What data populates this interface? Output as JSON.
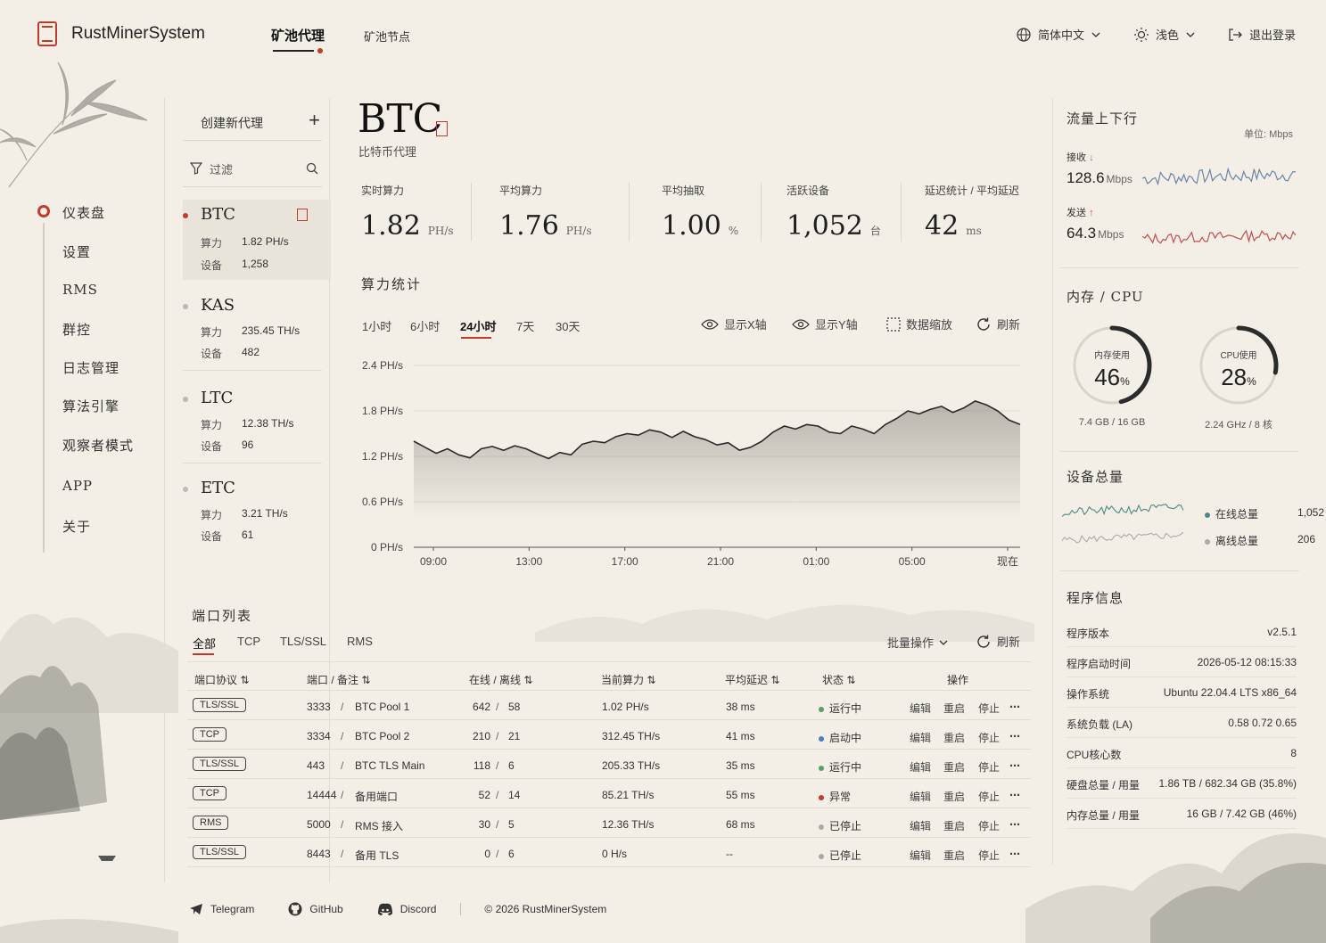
{
  "app": {
    "title": "RustMinerSystem"
  },
  "topnav": {
    "tabs": [
      {
        "label": "矿池代理"
      },
      {
        "label": "矿池节点"
      }
    ],
    "language": "简体中文",
    "theme": "浅色",
    "logout": "退出登录"
  },
  "sidebar": {
    "items": [
      {
        "label": "仪表盘"
      },
      {
        "label": "设置"
      },
      {
        "label": "RMS"
      },
      {
        "label": "群控"
      },
      {
        "label": "日志管理"
      },
      {
        "label": "算法引擎"
      },
      {
        "label": "观察者模式"
      },
      {
        "label": "APP"
      },
      {
        "label": "关于"
      }
    ]
  },
  "proxies": {
    "create_label": "创建新代理",
    "filter_label": "过滤",
    "hash_key": "算力",
    "device_key": "设备",
    "items": [
      {
        "name": "BTC",
        "hash": "1.82 PH/s",
        "devices": "1,258"
      },
      {
        "name": "KAS",
        "hash": "235.45 TH/s",
        "devices": "482"
      },
      {
        "name": "LTC",
        "hash": "12.38 TH/s",
        "devices": "96"
      },
      {
        "name": "ETC",
        "hash": "3.21 TH/s",
        "devices": "61"
      }
    ]
  },
  "main": {
    "coin": "BTC",
    "coin_sub": "比特币代理",
    "stats": [
      {
        "label": "实时算力",
        "value": "1.82",
        "unit": "PH/s"
      },
      {
        "label": "平均算力",
        "value": "1.76",
        "unit": "PH/s"
      },
      {
        "label": "平均抽取",
        "value": "1.00",
        "unit": "%"
      },
      {
        "label": "活跃设备",
        "value": "1,052",
        "unit": "台"
      },
      {
        "label": "延迟统计 / 平均延迟",
        "value": "42",
        "unit": "ms"
      }
    ],
    "hash_title": "算力统计",
    "ranges": [
      {
        "label": "1小时"
      },
      {
        "label": "6小时"
      },
      {
        "label": "24小时"
      },
      {
        "label": "7天"
      },
      {
        "label": "30天"
      }
    ],
    "tools": {
      "show_x": "显示X轴",
      "show_y": "显示Y轴",
      "zoom": "数据缩放",
      "refresh": "刷新"
    }
  },
  "chart_data": {
    "type": "area",
    "x_ticks": [
      "09:00",
      "13:00",
      "17:00",
      "21:00",
      "01:00",
      "05:00",
      "现在"
    ],
    "y_ticks": [
      "0 PH/s",
      "0.6 PH/s",
      "1.2 PH/s",
      "1.8 PH/s",
      "2.4 PH/s"
    ],
    "ylim": [
      0,
      2.4
    ],
    "grid": true,
    "series": [
      {
        "values": [
          1.4,
          1.32,
          1.24,
          1.3,
          1.22,
          1.18,
          1.3,
          1.33,
          1.28,
          1.34,
          1.3,
          1.23,
          1.17,
          1.25,
          1.22,
          1.36,
          1.4,
          1.38,
          1.46,
          1.5,
          1.48,
          1.55,
          1.52,
          1.45,
          1.53,
          1.46,
          1.42,
          1.35,
          1.38,
          1.28,
          1.32,
          1.4,
          1.52,
          1.6,
          1.56,
          1.62,
          1.6,
          1.52,
          1.5,
          1.6,
          1.56,
          1.5,
          1.62,
          1.7,
          1.8,
          1.76,
          1.82,
          1.86,
          1.78,
          1.84,
          1.93,
          1.88,
          1.8,
          1.68,
          1.62
        ]
      }
    ]
  },
  "ports": {
    "title": "端口列表",
    "tabs": [
      {
        "label": "全部"
      },
      {
        "label": "TCP"
      },
      {
        "label": "TLS/SSL"
      },
      {
        "label": "RMS"
      }
    ],
    "batch": "批量操作",
    "refresh": "刷新",
    "headers": {
      "proto": "端口协议",
      "port": "端口 / 备注",
      "online": "在线 / 离线",
      "hash": "当前算力",
      "latency": "平均延迟",
      "status": "状态",
      "ops": "操作"
    },
    "ops": {
      "edit": "编辑",
      "restart": "重启",
      "stop": "停止",
      "more": "⋯"
    },
    "rows": [
      {
        "proto": "TLS/SSL",
        "port": "3333",
        "note": "BTC Pool 1",
        "online": "642",
        "offline": "58",
        "hash": "1.02 PH/s",
        "latency": "38 ms",
        "status": "运行中",
        "status_color": "#5a9e6a"
      },
      {
        "proto": "TCP",
        "port": "3334",
        "note": "BTC Pool 2",
        "online": "210",
        "offline": "21",
        "hash": "312.45 TH/s",
        "latency": "41 ms",
        "status": "启动中",
        "status_color": "#4a7fc1"
      },
      {
        "proto": "TLS/SSL",
        "port": "443",
        "note": "BTC TLS Main",
        "online": "118",
        "offline": "6",
        "hash": "205.33 TH/s",
        "latency": "35 ms",
        "status": "运行中",
        "status_color": "#5a9e6a"
      },
      {
        "proto": "TCP",
        "port": "14444",
        "note": "备用端口",
        "online": "52",
        "offline": "14",
        "hash": "85.21 TH/s",
        "latency": "55 ms",
        "status": "异常",
        "status_color": "#c23a2c"
      },
      {
        "proto": "RMS",
        "port": "5000",
        "note": "RMS 接入",
        "online": "30",
        "offline": "5",
        "hash": "12.36 TH/s",
        "latency": "68 ms",
        "status": "已停止",
        "status_color": "#aaaaaa"
      },
      {
        "proto": "TLS/SSL",
        "port": "8443",
        "note": "备用 TLS",
        "online": "0",
        "offline": "6",
        "hash": "0 H/s",
        "latency": "--",
        "status": "已停止",
        "status_color": "#aaaaaa"
      }
    ]
  },
  "footer": {
    "telegram": "Telegram",
    "github": "GitHub",
    "discord": "Discord",
    "copyright": "© 2026 RustMinerSystem"
  },
  "right": {
    "traffic": {
      "title": "流量上下行",
      "unit": "单位: Mbps",
      "recv_label": "接收",
      "recv_value": "128.6",
      "send_label": "发送",
      "send_value": "64.3",
      "unit_short": "Mbps"
    },
    "memcpu": {
      "title": "内存 / CPU",
      "mem_label": "内存使用",
      "mem_value": "46",
      "mem_sub": "7.4 GB / 16 GB",
      "cpu_label": "CPU使用",
      "cpu_value": "28",
      "cpu_sub": "2.24 GHz / 8 核",
      "percent": "%"
    },
    "devices": {
      "title": "设备总量",
      "online_label": "在线总量",
      "online_value": "1,052",
      "offline_label": "离线总量",
      "offline_value": "206"
    },
    "program": {
      "title": "程序信息",
      "rows": [
        {
          "k": "程序版本",
          "v": "v2.5.1"
        },
        {
          "k": "程序启动时间",
          "v": "2026-05-12  08:15:33"
        },
        {
          "k": "操作系统",
          "v": "Ubuntu 22.04.4 LTS x86_64"
        },
        {
          "k": "系统负载 (LA)",
          "v": "0.58    0.72    0.65"
        },
        {
          "k": "CPU核心数",
          "v": "8"
        },
        {
          "k": "硬盘总量 / 用量",
          "v": "1.86 TB / 682.34 GB (35.8%)"
        },
        {
          "k": "内存总量 / 用量",
          "v": "16 GB / 7.42 GB (46%)"
        }
      ]
    }
  },
  "colors": {
    "accent": "#c23a2c",
    "online": "#4d8a8a",
    "offline": "#aaaaaa",
    "recv": "#6b85a8",
    "send": "#c0504d"
  }
}
